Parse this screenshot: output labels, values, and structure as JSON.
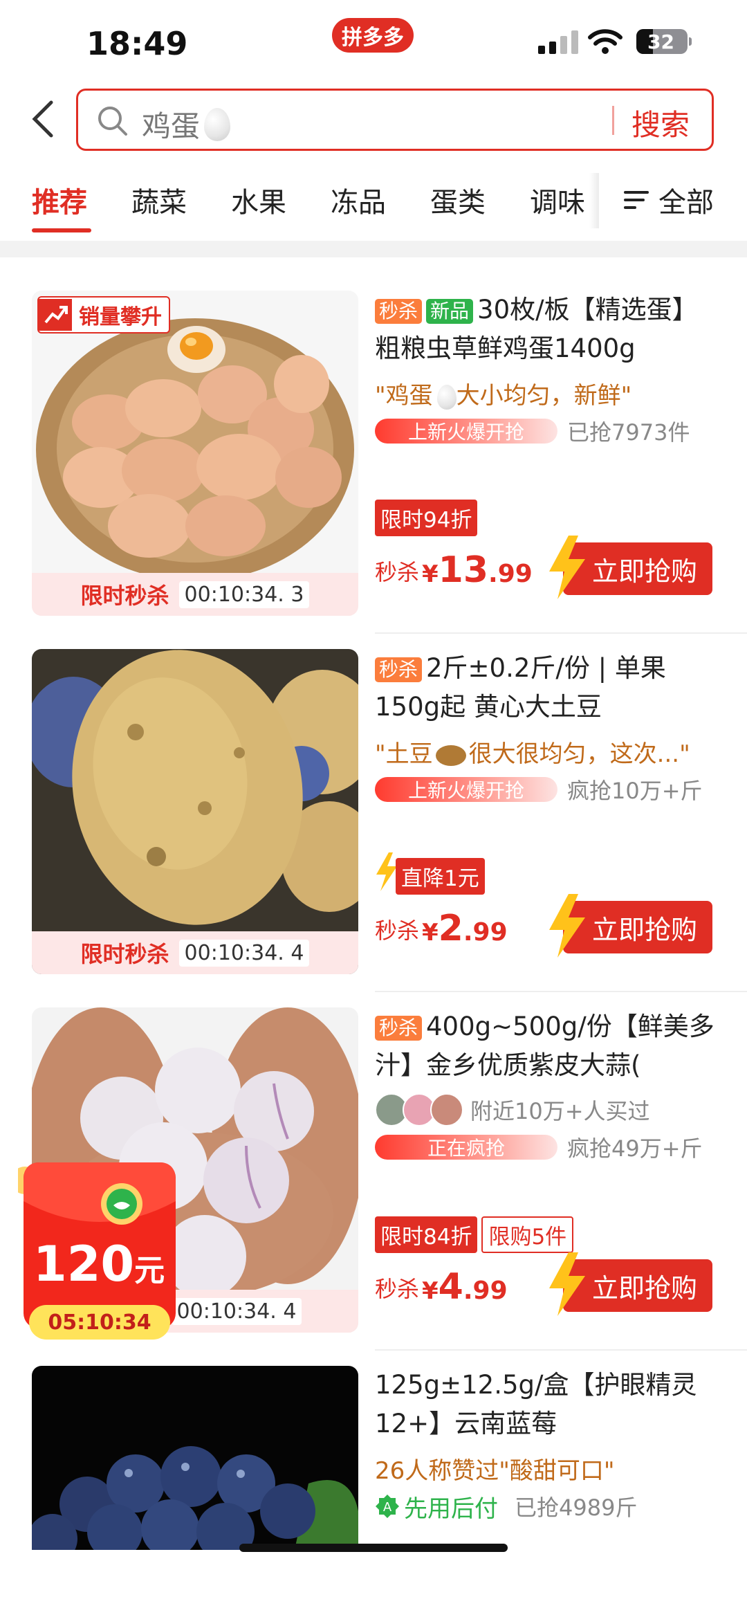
{
  "status_bar": {
    "time": "18:49",
    "app_badge": "拼多多",
    "battery": "32"
  },
  "search": {
    "query": "鸡蛋",
    "button": "搜索"
  },
  "tabs": [
    {
      "label": "推荐"
    },
    {
      "label": "蔬菜"
    },
    {
      "label": "水果"
    },
    {
      "label": "冻品"
    },
    {
      "label": "蛋类"
    },
    {
      "label": "调味"
    }
  ],
  "all_tab": "全部",
  "products": [
    {
      "badge": "销量攀升",
      "tags": [
        "秒杀",
        "新品"
      ],
      "title": "30枚/板【精选蛋】粗粮虫草鲜鸡蛋1400g",
      "quote_a": "\"鸡蛋",
      "quote_b": "大小均匀，新鲜\"",
      "hot": "上新火爆开抢",
      "sold": "已抢7973件",
      "promo": "限时94折",
      "price_prefix": "秒杀",
      "price_sym": "¥",
      "price_int": "13",
      "price_dec": ".99",
      "buy": "立即抢购",
      "flash_label": "限时秒杀",
      "countdown": "00:10:34. 3"
    },
    {
      "tags": [
        "秒杀"
      ],
      "title": "2斤±0.2斤/份 | 单果150g起 黄心大土豆",
      "quote_a": "\"土豆",
      "quote_b": "很大很均匀，这次...\"",
      "hot": "上新火爆开抢",
      "sold": "疯抢10万+斤",
      "promo": "直降1元",
      "price_prefix": "秒杀",
      "price_sym": "¥",
      "price_int": "2",
      "price_dec": ".99",
      "buy": "立即抢购",
      "flash_label": "限时秒杀",
      "countdown": "00:10:34. 4"
    },
    {
      "tags": [
        "秒杀"
      ],
      "title": "400g~500g/份【鲜美多汁】金乡优质紫皮大蒜(",
      "nearby": "附近10万+人买过",
      "hot": "正在疯抢",
      "sold": "疯抢49万+斤",
      "promo": "限时84折",
      "promo2": "限购5件",
      "price_prefix": "秒杀",
      "price_sym": "¥",
      "price_int": "4",
      "price_dec": ".99",
      "buy": "立即抢购",
      "countdown": "00:10:34. 4"
    },
    {
      "title": "125g±12.5g/盒【护眼精灵12+】云南蓝莓",
      "quote": "26人称赞过\"酸甜可口\"",
      "pay_later": "先用后付",
      "sold": "已抢4989斤"
    }
  ],
  "red_envelope": {
    "amount": "120",
    "unit": "元",
    "timer": "05:10:34"
  },
  "colors": {
    "brand_red": "#e02e24",
    "tag_orange": "#fb7d3c",
    "tag_green": "#2eb34b",
    "quote_brown": "#c06a1a"
  }
}
